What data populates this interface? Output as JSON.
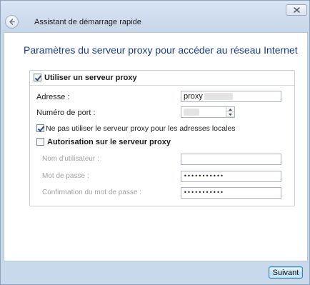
{
  "window": {
    "title": "Assistant de démarrage rapide",
    "close_icon": "close-icon",
    "back_icon": "back-arrow-icon"
  },
  "main": {
    "heading": "Paramètres du serveur proxy pour accéder au réseau Internet",
    "heading_color": "#1a3e8c"
  },
  "proxy": {
    "use_proxy_label": "Utiliser un serveur proxy",
    "use_proxy_checked": true,
    "address_label": "Adresse :",
    "address_value": "proxy",
    "port_label": "Numéro de port :",
    "bypass_local_label": "Ne pas utiliser le serveur proxy pour les adresses locales",
    "bypass_local_checked": true,
    "auth_label": "Autorisation sur le serveur proxy",
    "auth_checked": false,
    "username_label": "Nom d'utilisateur :",
    "username_value": "",
    "password_label": "Mot de passe :",
    "password_value": "•••••••••••",
    "confirm_label": "Confirmation du mot de passe :",
    "confirm_value": "•••••••••••"
  },
  "footer": {
    "next_label": "Suivant"
  }
}
